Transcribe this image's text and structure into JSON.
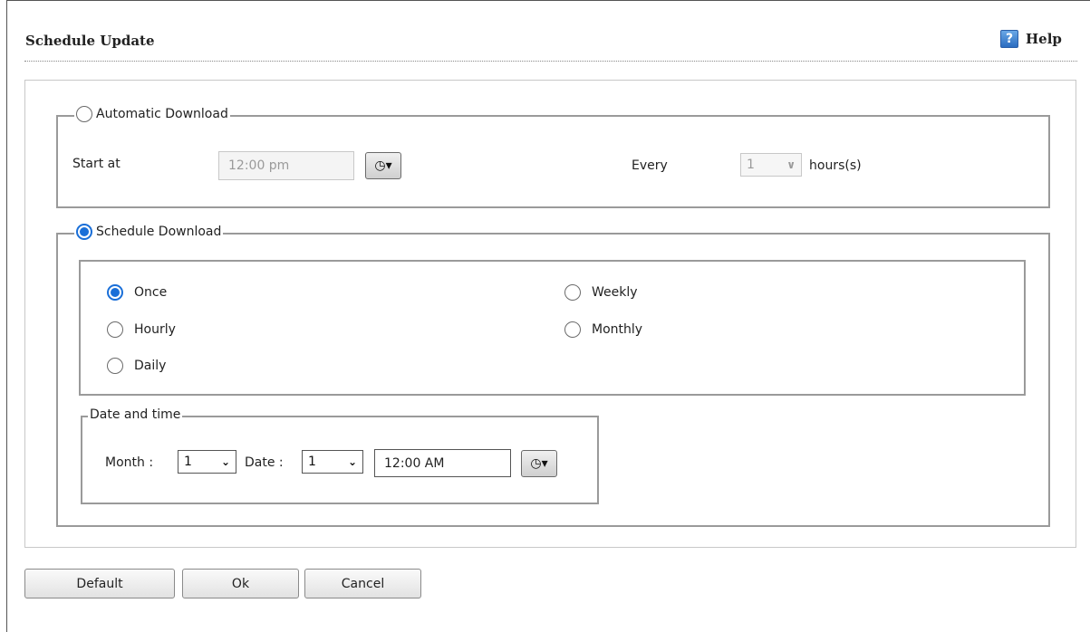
{
  "header": {
    "title": "Schedule Update",
    "help_label": "Help",
    "help_icon": "?"
  },
  "automatic": {
    "legend": "Automatic Download",
    "selected": false,
    "start_label": "Start at",
    "start_value": "12:00 pm",
    "every_label": "Every",
    "every_value": "1",
    "hours_label": "hours(s)"
  },
  "schedule": {
    "legend": "Schedule Download",
    "selected": true,
    "frequency": {
      "once": "Once",
      "hourly": "Hourly",
      "daily": "Daily",
      "weekly": "Weekly",
      "monthly": "Monthly",
      "selected": "Once"
    },
    "datetime": {
      "legend": "Date and time",
      "month_label": "Month :",
      "month_value": "1",
      "date_label": "Date :",
      "date_value": "1",
      "time_value": "12:00 AM"
    }
  },
  "buttons": {
    "default": "Default",
    "ok": "Ok",
    "cancel": "Cancel"
  },
  "icons": {
    "clock": "clock-dropdown-icon",
    "help": "help-icon",
    "chevron": "chevron-down-icon"
  }
}
